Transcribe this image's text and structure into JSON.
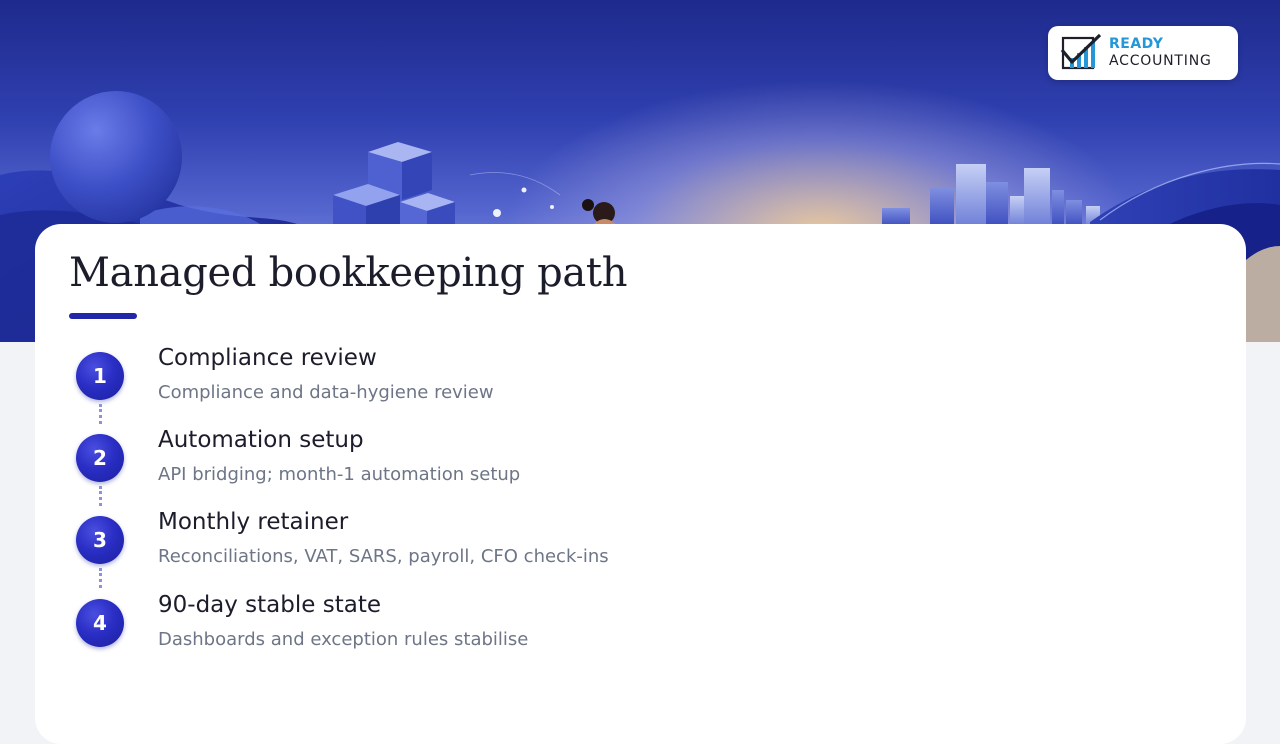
{
  "brand": {
    "name_line1": "READY",
    "name_line2": "ACCOUNTING",
    "logo_icon": "checkmark-bar-chart-icon",
    "accent_color": "#2596d6"
  },
  "slide": {
    "title": "Managed bookkeeping path",
    "accent_color": "#2226a8"
  },
  "steps": [
    {
      "number": "1",
      "title": "Compliance review",
      "description": "Compliance and data-hygiene review"
    },
    {
      "number": "2",
      "title": "Automation setup",
      "description": "API bridging; month-1 automation setup"
    },
    {
      "number": "3",
      "title": "Monthly retainer",
      "description": "Reconciliations, VAT, SARS, payroll, CFO check-ins"
    },
    {
      "number": "4",
      "title": "90-day stable state",
      "description": "Dashboards and exception rules stabilise"
    }
  ]
}
